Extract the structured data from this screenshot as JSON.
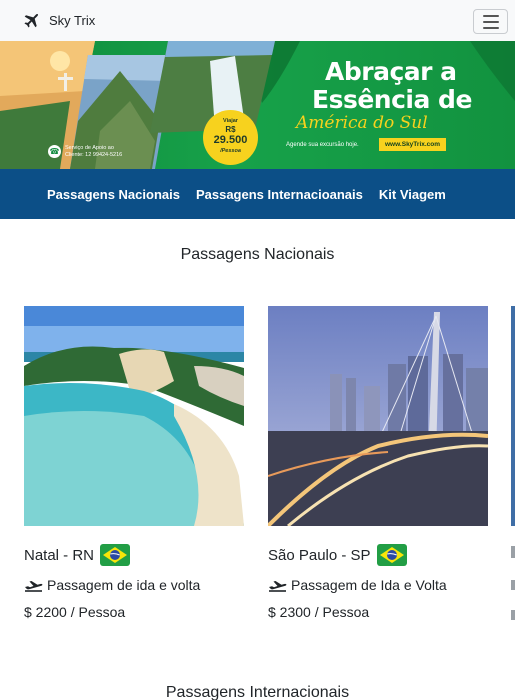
{
  "navbar": {
    "brand": "Sky Trix",
    "brand_icon": "airplane-icon",
    "toggler_icon": "hamburger-menu-icon"
  },
  "banner": {
    "headline_line1": "Abraçar a",
    "headline_line2": "Essência de",
    "script_line": "América do Sul",
    "price_label": "Viajar",
    "price_currency": "R$",
    "price_value": "29.500",
    "price_unit": "/Pessoa",
    "support_text": "Serviço de Apoio ao Cliente: 12 99424-5216",
    "cta_text": "Agende sua excursão hoje.",
    "site": "www.SkyTrix.com",
    "nav_links": [
      "Passagens Nacionais",
      "Passagens Internacioanais",
      "Kit Viagem"
    ]
  },
  "sections": {
    "nacionais_title": "Passagens Nacionais",
    "internacionais_title": "Passagens Internacionais"
  },
  "cards": [
    {
      "title": "Natal - RN",
      "flag": "brazil-flag-icon",
      "description": "Passagem de ida e volta",
      "price": "$ 2200 / Pessoa"
    },
    {
      "title": "São Paulo - SP",
      "flag": "brazil-flag-icon",
      "description": "Passagem de Ida e Volta",
      "price": "$ 2300 / Pessoa"
    }
  ],
  "colors": {
    "navbar_bg": "#f8f9fa",
    "banner_green": "#17a24a",
    "banner_nav_blue": "#0c4f87",
    "accent_yellow": "#f7d21e",
    "text": "#212529"
  }
}
